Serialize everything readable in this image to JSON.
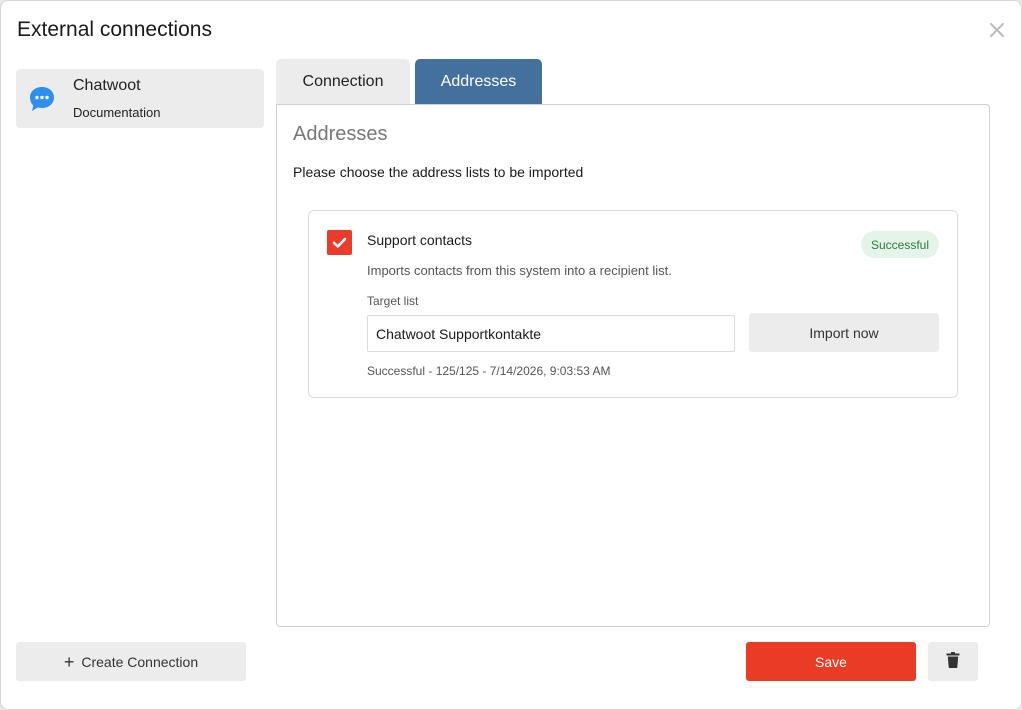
{
  "dialog": {
    "title": "External connections"
  },
  "sidebar": {
    "items": [
      {
        "label": "Chatwoot",
        "sublabel": "Documentation",
        "icon": "chat-bubble-icon"
      }
    ],
    "create_label": "Create Connection"
  },
  "tabs": [
    {
      "label": "Connection",
      "active": false
    },
    {
      "label": "Addresses",
      "active": true
    }
  ],
  "panel": {
    "title": "Addresses",
    "subtitle": "Please choose the address lists to be imported",
    "card": {
      "checked": true,
      "title": "Support contacts",
      "badge": "Successful",
      "description": "Imports contacts from this system into a recipient list.",
      "target_label": "Target list",
      "target_value": "Chatwoot Supportkontakte",
      "import_label": "Import now",
      "status_line": "Successful - 125/125 - 7/14/2026, 9:03:53 AM"
    }
  },
  "footer": {
    "save_label": "Save"
  },
  "colors": {
    "accent": "#ea3b25",
    "tab_active": "#44709d",
    "badge_bg": "#e4f4e8",
    "badge_text": "#2f7a3e"
  }
}
